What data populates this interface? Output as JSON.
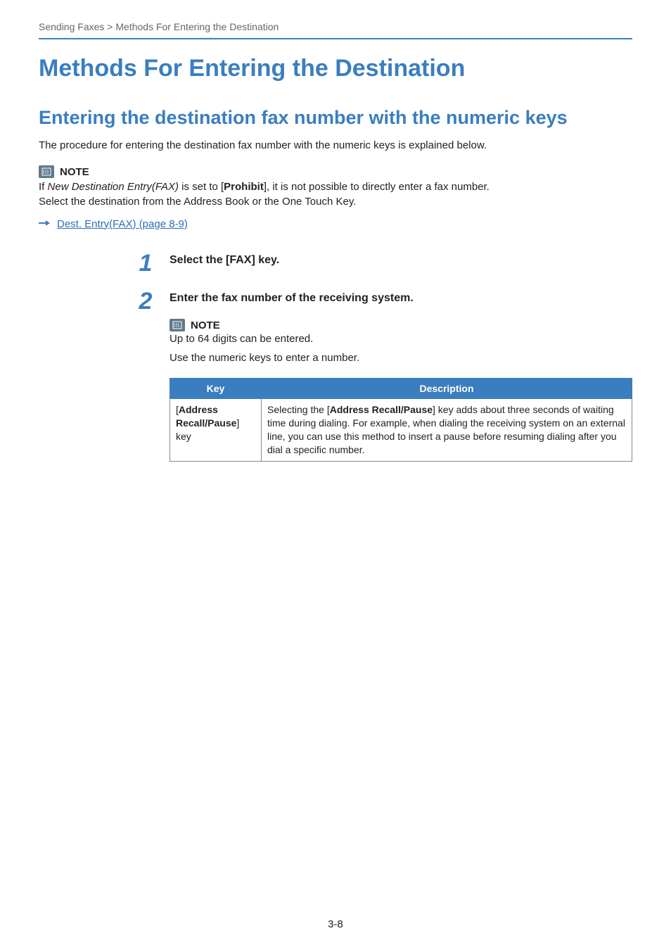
{
  "header": {
    "breadcrumb_section": "Sending Faxes",
    "breadcrumb_sep": " > ",
    "breadcrumb_page": "Methods For Entering the Destination"
  },
  "h1": "Methods For Entering the Destination",
  "h2": "Entering the destination fax number with the numeric keys",
  "intro": "The procedure for entering the destination fax number with the numeric keys is explained below.",
  "note1": {
    "label": "NOTE",
    "line1_prefix": " If ",
    "line1_italic": "New Destination Entry(FAX)",
    "line1_mid": " is set to [",
    "line1_bold": "Prohibit",
    "line1_suffix": "], it is not possible to directly enter a fax number.",
    "line2": "Select the destination from the Address Book or the One Touch Key."
  },
  "link1": {
    "text": "Dest. Entry(FAX) (page 8-9)"
  },
  "steps": [
    {
      "num": "1",
      "title": "Select the [FAX] key."
    },
    {
      "num": "2",
      "title": "Enter the fax number of the receiving system.",
      "note": {
        "label": "NOTE",
        "line1": "Up to 64 digits can be entered.",
        "line2": "Use the numeric keys to enter a number."
      },
      "table": {
        "headers": [
          "Key",
          "Description"
        ],
        "row": {
          "key_prefix": "[",
          "key_bold": "Address Recall/Pause",
          "key_suffix": "] key",
          "desc_prefix": "Selecting the [",
          "desc_bold": "Address Recall/Pause",
          "desc_suffix": "] key adds about three seconds of waiting time during dialing. For example, when dialing the receiving system on an external line, you can use this method to insert a pause before resuming dialing after you dial a specific number."
        }
      }
    }
  ],
  "page_number": "3-8"
}
